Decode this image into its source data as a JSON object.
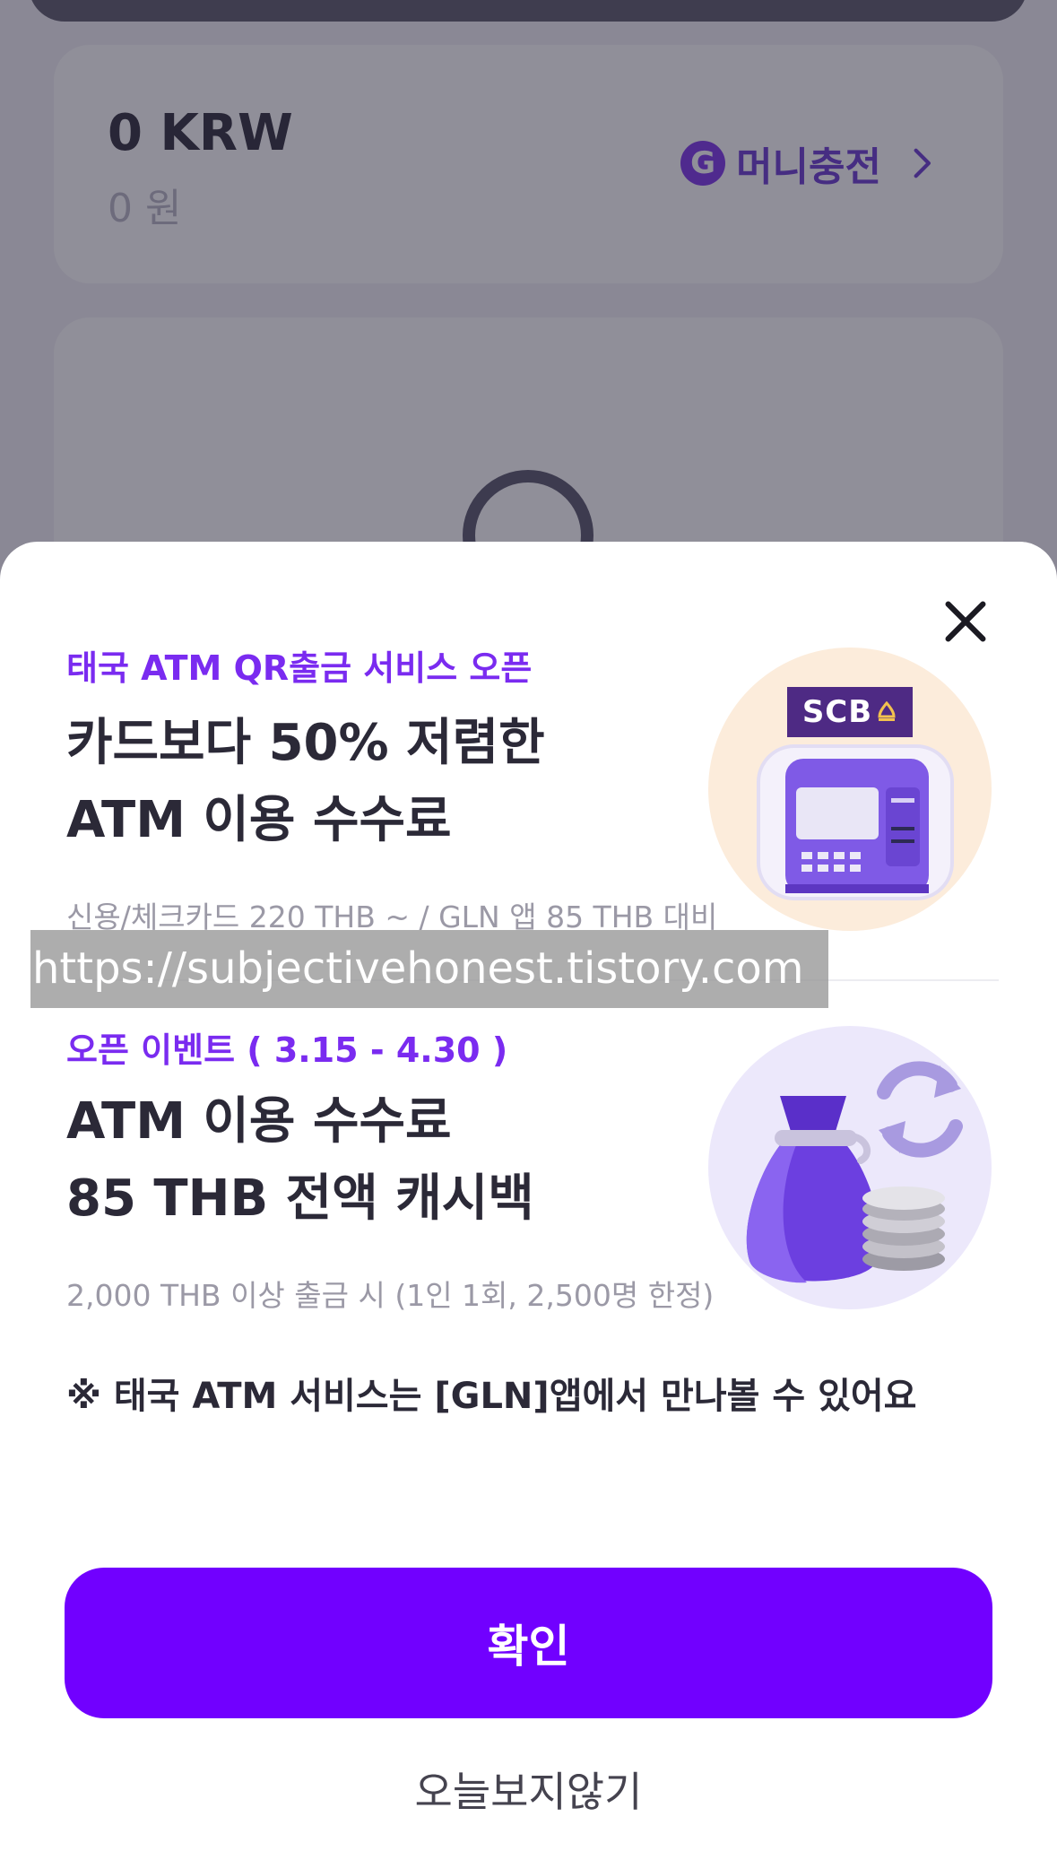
{
  "background": {
    "balance_krw": "0 KRW",
    "balance_won": "0 원",
    "charge_badge": "G",
    "charge_label": "머니충전"
  },
  "popup": {
    "section1": {
      "tag": "태국 ATM QR출금 서비스 오픈",
      "headline_line1": "카드보다 50% 저렴한",
      "headline_line2": "ATM 이용 수수료",
      "sub": "신용/체크카드 220 THB ~ / GLN 앱 85 THB 대비",
      "atm_brand": "SCB"
    },
    "section2": {
      "tag": "오픈 이벤트  ( 3.15 - 4.30 )",
      "headline_line1": "ATM 이용 수수료",
      "headline_line2": "85 THB 전액 캐시백",
      "sub": "2,000 THB 이상 출금 시 (1인 1회, 2,500명 한정)"
    },
    "notice": "※ 태국 ATM 서비스는 [GLN]앱에서 만나볼 수 있어요",
    "confirm_label": "확인",
    "dont_show_label": "오늘보지않기"
  },
  "watermark": "https://subjectivehonest.tistory.com",
  "colors": {
    "accent": "#7100ff",
    "tag": "#7a2bf0",
    "scb": "#4e2a84"
  },
  "icons": {
    "close": "close-icon",
    "chevron": "chevron-right-icon",
    "atm": "atm-machine-icon",
    "money_bag": "money-bag-icon",
    "refresh": "refresh-icon"
  }
}
